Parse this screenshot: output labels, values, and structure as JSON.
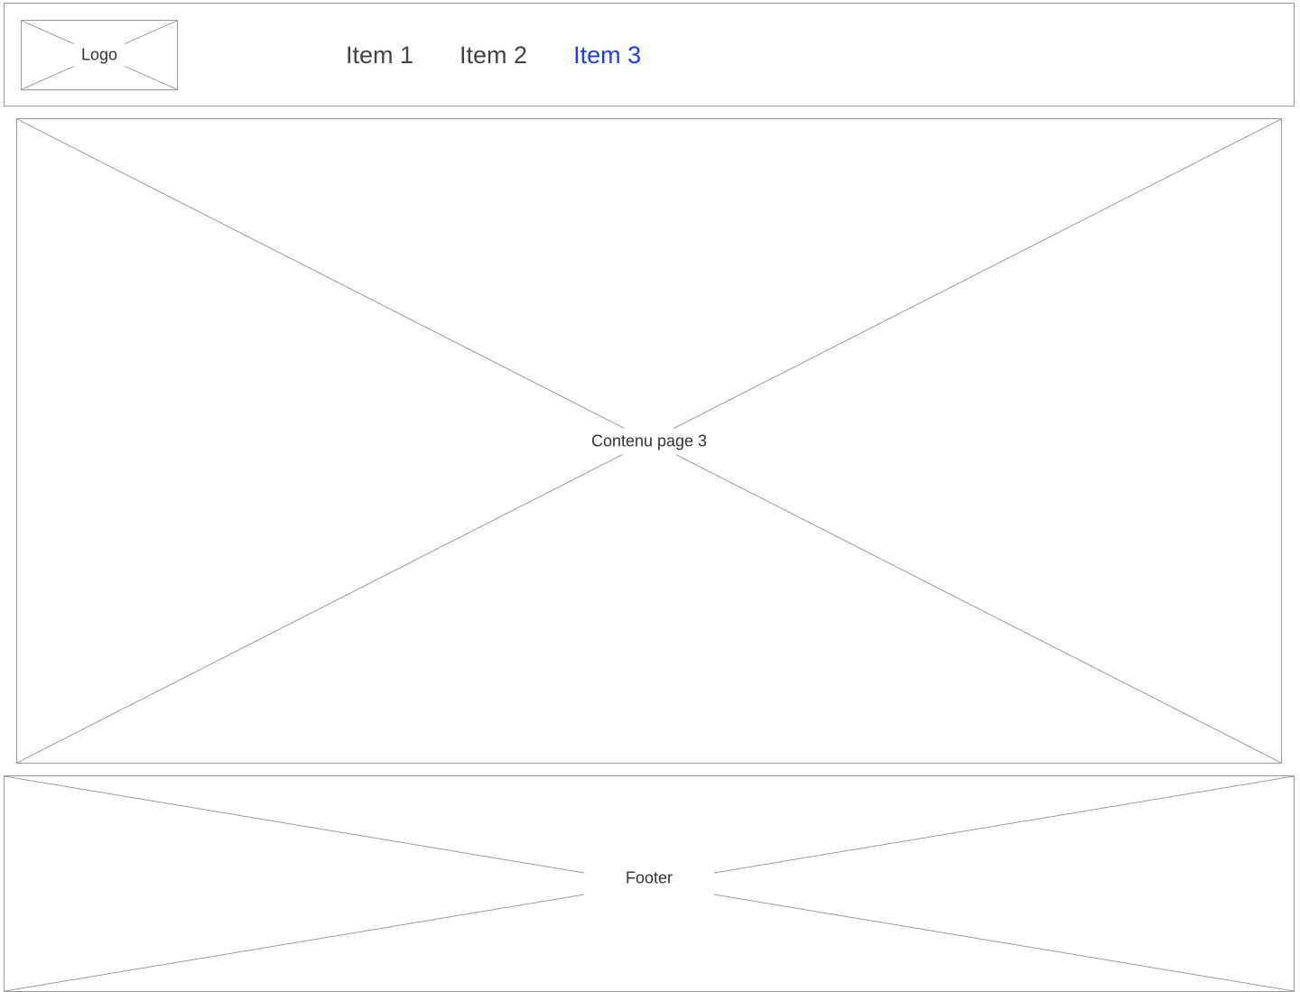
{
  "header": {
    "logo_label": "Logo",
    "nav": {
      "items": [
        {
          "label": "Item 1",
          "active": false
        },
        {
          "label": "Item 2",
          "active": false
        },
        {
          "label": "Item 3",
          "active": true
        }
      ]
    }
  },
  "content": {
    "label": "Contenu page 3"
  },
  "footer": {
    "label": "Footer"
  },
  "colors": {
    "wireframe_stroke": "#9a9a9a",
    "text": "#444444",
    "active_nav": "#1b3ff0"
  }
}
